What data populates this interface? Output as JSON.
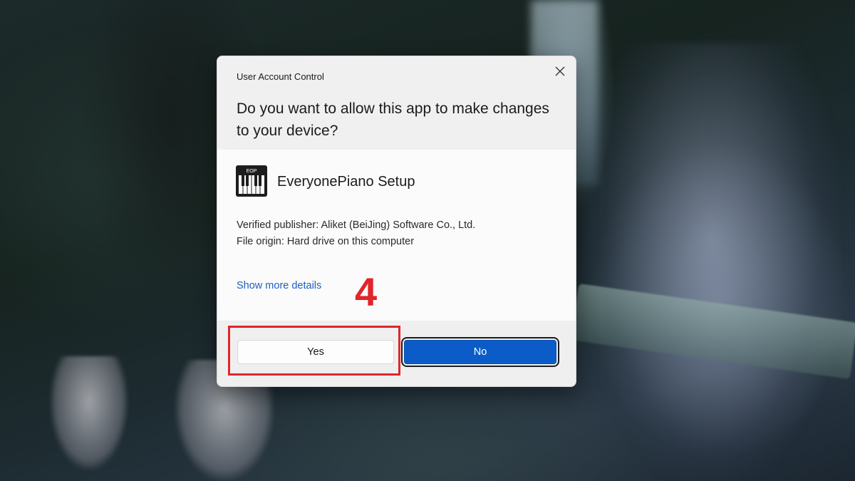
{
  "dialog": {
    "title": "User Account Control",
    "question": "Do you want to allow this app to make changes to your device?",
    "app": {
      "name": "EveryonePiano Setup",
      "icon": "piano-keys-icon",
      "icon_label": "EOP"
    },
    "publisher": "Verified publisher: Aliket (BeiJing) Software Co., Ltd.",
    "origin": "File origin: Hard drive on this computer",
    "details_link": "Show more details",
    "buttons": {
      "yes": "Yes",
      "no": "No"
    },
    "close_icon": "close-icon"
  },
  "annotation": {
    "step": "4",
    "color": "#e1252b"
  },
  "colors": {
    "primary_button": "#0b5cc9",
    "link": "#1f5fbf"
  }
}
